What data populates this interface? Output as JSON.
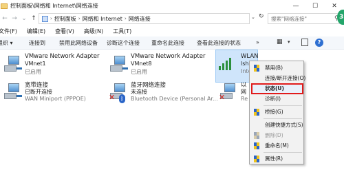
{
  "window": {
    "title": "控制面板\\网络和 Internet\\网络连接",
    "minimize_label": "—",
    "maximize_label": "☐",
    "close_label": "✕"
  },
  "address": {
    "back_label": "←",
    "forward_label": "→",
    "up_label": "↑",
    "breadcrumbs": [
      "控制面板",
      "网络和 Internet",
      "网络连接"
    ],
    "separator": "›",
    "search_placeholder": "搜索\"网络连接\""
  },
  "menubar": {
    "items": [
      "文件(F)",
      "编辑(E)",
      "查看(V)",
      "高级(N)",
      "工具(T)"
    ]
  },
  "commandbar": {
    "items": [
      "组织 ▾",
      "连接到",
      "禁用此网络设备",
      "诊断这个连接",
      "重命名此连接",
      "查看此连接的状态",
      "»"
    ]
  },
  "connections": [
    {
      "name": "VMware Network Adapter",
      "sub": "VMnet1",
      "detail": "已启用"
    },
    {
      "name": "VMware Network Adapter",
      "sub": "VMnet8",
      "detail": "已启用"
    },
    {
      "name": "WLAN",
      "sub": "lsh",
      "detail": "Intel"
    },
    {
      "name": "宽带连接",
      "sub": "已断开连接",
      "detail": "WAN Miniport (PPPOE)"
    },
    {
      "name": "蓝牙网络连接",
      "sub": "未连接",
      "detail": "Bluetooth Device (Personal Ar..."
    },
    {
      "name": "以",
      "sub": "网",
      "detail": "Re"
    }
  ],
  "context_menu": {
    "items": [
      {
        "label": "禁用(B)",
        "enabled": true,
        "shield": true
      },
      {
        "label": "连接/断开连接(O)",
        "enabled": true,
        "shield": false
      },
      {
        "label": "状态(U)",
        "enabled": true,
        "shield": false,
        "highlighted": true
      },
      {
        "label": "诊断(I)",
        "enabled": true,
        "shield": false
      },
      {
        "label": "桥接(G)",
        "enabled": true,
        "shield": true
      },
      {
        "label": "创建快捷方式(S)",
        "enabled": true,
        "shield": false
      },
      {
        "label": "删除(D)",
        "enabled": false,
        "shield": true
      },
      {
        "label": "重命名(M)",
        "enabled": true,
        "shield": true
      },
      {
        "label": "属性(R)",
        "enabled": true,
        "shield": true
      }
    ]
  },
  "badge": {
    "label": "3"
  },
  "colors": {
    "highlight_border": "#e11b1b",
    "selection_fill": "#cfe5fb",
    "help_blue": "#2e6fd1",
    "badge_green": "#23a56a"
  }
}
